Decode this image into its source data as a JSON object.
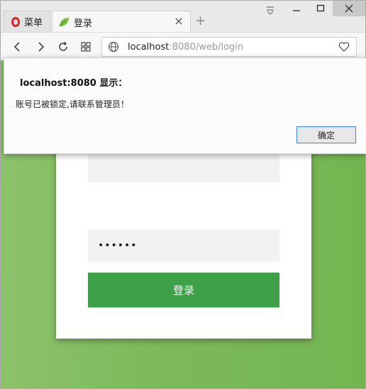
{
  "browser": {
    "menu_tab_label": "菜单",
    "active_tab_title": "登录",
    "url_host": "localhost",
    "url_rest": ":8080/web/login"
  },
  "login_form": {
    "username_value": "",
    "password_masked": "••••••",
    "login_button": "登录"
  },
  "dialog": {
    "title": "localhost:8080 显示：",
    "message": "账号已被锁定,请联系管理员！",
    "ok_button": "确定"
  },
  "icons": {
    "menu": "opera-logo-icon",
    "tab": "leaf-icon",
    "back": "back-arrow-icon",
    "forward": "forward-arrow-icon",
    "reload": "reload-icon",
    "speed_dial": "grid-icon",
    "site_info": "globe-icon",
    "bookmark": "heart-icon"
  },
  "colors": {
    "page_gradient_start": "#8cc26b",
    "page_gradient_end": "#74b552",
    "login_button": "#3fa04a",
    "opera_red": "#e0232b",
    "focus_border": "#3c86d8"
  }
}
